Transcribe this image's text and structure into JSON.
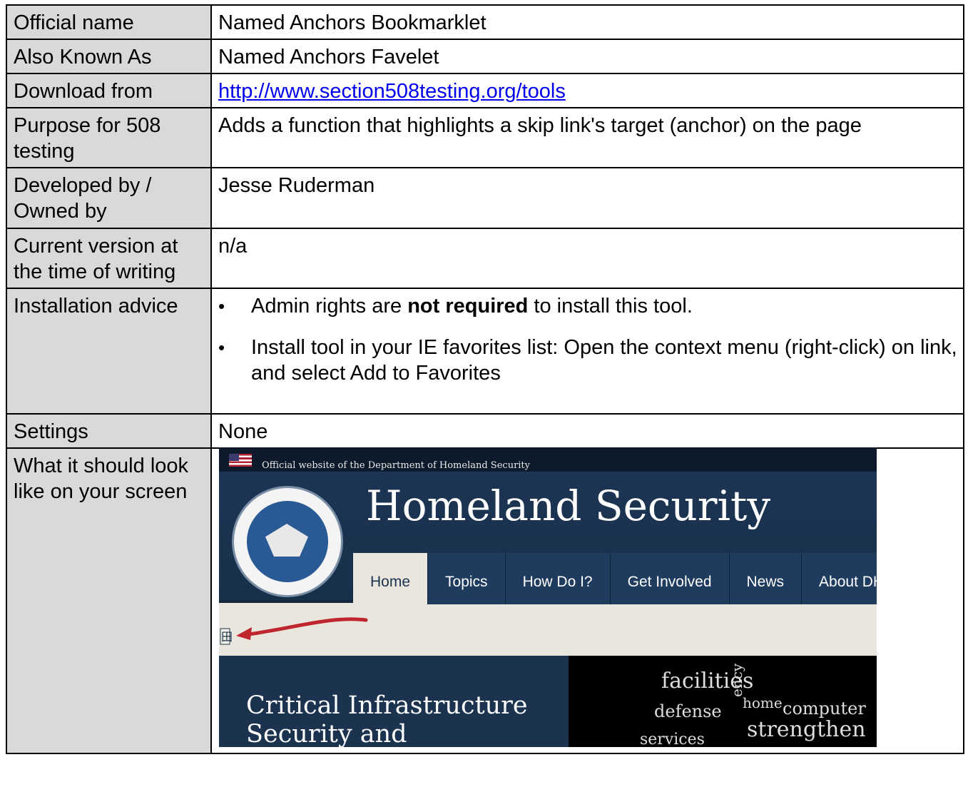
{
  "rows": {
    "official_name": {
      "label": "Official name",
      "value": "Named Anchors Bookmarklet"
    },
    "aka": {
      "label": "Also Known As",
      "value": "Named Anchors Favelet"
    },
    "download": {
      "label": "Download from",
      "value": "http://www.section508testing.org/tools"
    },
    "purpose": {
      "label": "Purpose for 508 testing",
      "value": "Adds a function that highlights a skip link's target (anchor) on the page"
    },
    "developer": {
      "label": "Developed by / Owned by",
      "value": "Jesse Ruderman"
    },
    "version": {
      "label": "Current version at the time of writing",
      "value": "n/a"
    },
    "install": {
      "label": "Installation advice",
      "item1_pre": "Admin rights are ",
      "item1_bold": "not required",
      "item1_post": " to install this tool.",
      "item2": "Install tool in your IE favorites list: Open the context menu (right-click) on link, and select Add to Favorites"
    },
    "settings": {
      "label": "Settings",
      "value": "None"
    },
    "screen": {
      "label": "What it should look like on your screen"
    }
  },
  "screenshot": {
    "official_text": "Official website of the Department of Homeland Security",
    "site_title": "Homeland Security",
    "nav": [
      "Home",
      "Topics",
      "How Do I?",
      "Get Involved",
      "News",
      "About DH"
    ],
    "headline_line1": "Critical Infrastructure",
    "headline_line2": "Security and",
    "words": [
      "facilities",
      "defense",
      "home",
      "computer",
      "strengthen",
      "services",
      "ency"
    ],
    "anchor_glyph": "田"
  },
  "colors": {
    "label_bg": "#d9d9d9",
    "link": "#0000ee",
    "dhs_navy": "#1c3350",
    "arrow_red": "#c0262d"
  }
}
